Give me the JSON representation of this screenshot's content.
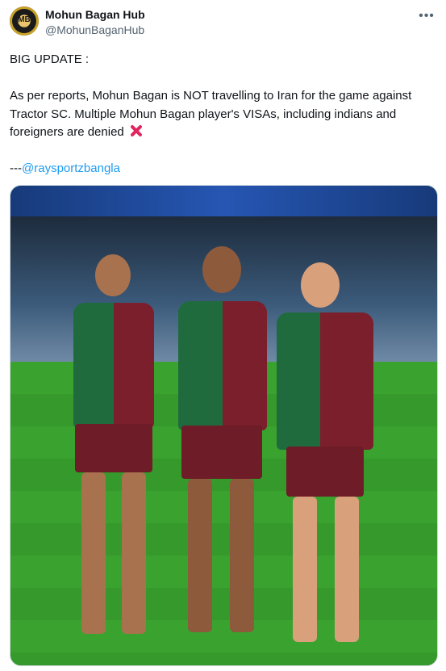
{
  "account": {
    "avatar_text": "MB",
    "display_name": "Mohun Bagan Hub",
    "handle": "@MohunBaganHub"
  },
  "tweet": {
    "headline": "BIG UPDATE :",
    "body": "As per reports, Mohun Bagan is NOT travelling to Iran for the game against Tractor SC. Multiple Mohun Bagan player's VISAs, including indians and foreigners are denied",
    "credit_prefix": "---",
    "credit_mention": "@raysportzbangla"
  },
  "icons": {
    "more": "more-options-icon",
    "deny": "cross-mark-icon"
  },
  "colors": {
    "link": "#1d9bf0",
    "cross": "#e0245e",
    "green_shirt": "#1f6b3d",
    "maroon_shirt": "#7a1f2b"
  }
}
